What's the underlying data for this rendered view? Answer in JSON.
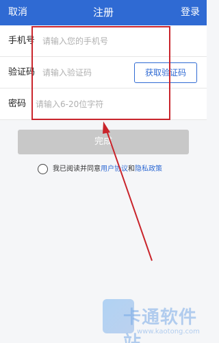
{
  "header": {
    "cancel_label": "取消",
    "title": "注册",
    "login_label": "登录"
  },
  "form": {
    "phone": {
      "label": "手机号",
      "placeholder": "请输入您的手机号"
    },
    "code": {
      "label": "验证码",
      "placeholder": "请输入验证码",
      "button_label": "获取验证码"
    },
    "password": {
      "label": "密码",
      "placeholder": "请输入6-20位字符"
    }
  },
  "submit_label": "完成",
  "agreement": {
    "prefix": "我已阅读并同意",
    "user_agreement": "用户协议",
    "and": "和",
    "privacy_policy": "隐私政策",
    "checked": false
  },
  "watermark": {
    "brand": "卡通软件站",
    "url": "www.kaotong.com"
  },
  "colors": {
    "accent": "#2f6ad3",
    "annotation": "#c9242b",
    "submit_disabled": "#c8c8c8"
  }
}
